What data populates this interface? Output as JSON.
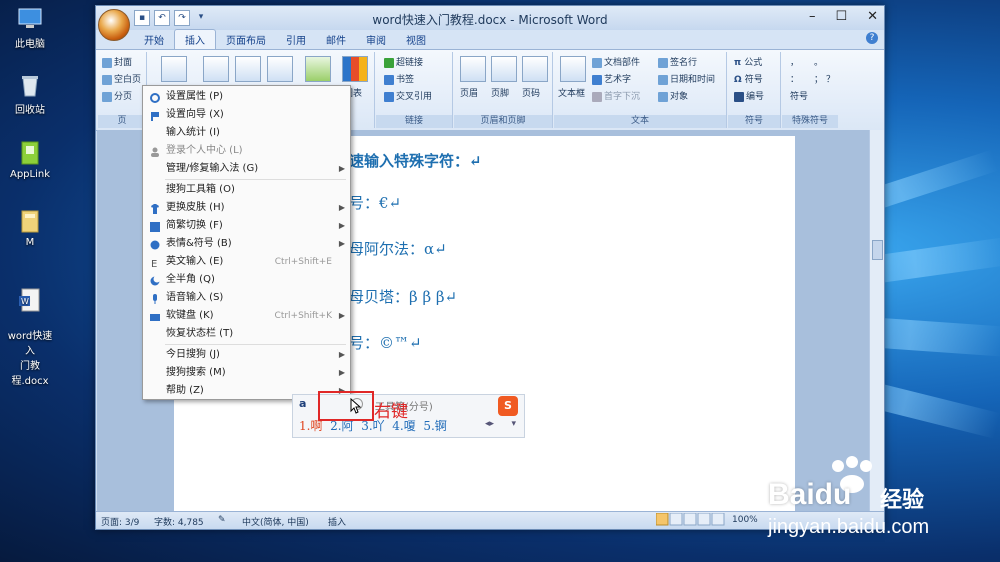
{
  "desktop": {
    "icons": [
      {
        "label": "此电脑"
      },
      {
        "label": "回收站"
      },
      {
        "label": "AppLink"
      },
      {
        "label": "M"
      },
      {
        "label": "word快速入\n门教程.docx"
      }
    ]
  },
  "window": {
    "title": "word快速入门教程.docx - Microsoft Word",
    "controls": {
      "minimize": "–",
      "maximize": "☐",
      "close": "✕"
    }
  },
  "tabs": [
    "开始",
    "插入",
    "页面布局",
    "引用",
    "邮件",
    "审阅",
    "视图"
  ],
  "ribbon": {
    "pages_group": {
      "items": [
        "封面",
        "空白页",
        "分页"
      ],
      "label": "页"
    },
    "illustrations": {
      "chart_label": "图表"
    },
    "links": {
      "items": [
        "超链接",
        "书签",
        "交叉引用"
      ],
      "label": "链接"
    },
    "header_footer": {
      "items": [
        "页眉",
        "页脚",
        "页码"
      ],
      "label": "页眉和页脚"
    },
    "text": {
      "items": [
        "文本框",
        "文档部件",
        "艺术字",
        "首字下沉",
        "签名行",
        "日期和时间",
        "对象"
      ],
      "label": "文本"
    },
    "symbols": {
      "items": [
        "公式",
        "符号",
        "编号"
      ],
      "label": "符号"
    },
    "special_symbols": {
      "items": [
        "，",
        "。",
        "：",
        "；",
        "？",
        "符号"
      ],
      "label": "特殊符号"
    }
  },
  "document": {
    "lines": [
      "速输入特殊字符：↵",
      "号：€↵",
      "母阿尔法：α↵",
      "母贝塔：β  β β↵",
      "号：©™↵"
    ]
  },
  "context_menu": {
    "items": [
      {
        "label": "设置属性",
        "key": "(P)",
        "icon": "gear-icon",
        "submenu": false
      },
      {
        "label": "设置向导",
        "key": "(X)",
        "icon": "flag-icon",
        "submenu": false
      },
      {
        "label": "输入统计",
        "key": "(I)",
        "icon": "",
        "submenu": false
      },
      {
        "label": "登录个人中心",
        "key": "(L)",
        "icon": "user-icon",
        "submenu": false
      },
      {
        "label": "管理/修复输入法",
        "key": "(G)",
        "icon": "",
        "submenu": true
      },
      {
        "label": "搜狗工具箱",
        "key": "(O)",
        "icon": "",
        "submenu": false
      },
      {
        "label": "更换皮肤",
        "key": "(H)",
        "icon": "shirt-icon",
        "submenu": true
      },
      {
        "label": "简繁切换",
        "key": "(F)",
        "icon": "convert-icon",
        "submenu": true
      },
      {
        "label": "表情&符号",
        "key": "(B)",
        "icon": "smiley-icon",
        "submenu": true
      },
      {
        "label": "英文输入",
        "key": "(E)",
        "icon": "letter-e-icon",
        "shortcut": "Ctrl+Shift+E",
        "submenu": false
      },
      {
        "label": "全半角",
        "key": "(Q)",
        "icon": "moon-icon",
        "submenu": false
      },
      {
        "label": "语音输入",
        "key": "(S)",
        "icon": "mic-icon",
        "submenu": false
      },
      {
        "label": "软键盘",
        "key": "(K)",
        "icon": "keyboard-icon",
        "shortcut": "Ctrl+Shift+K",
        "submenu": true
      },
      {
        "label": "恢复状态栏",
        "key": "(T)",
        "icon": "",
        "submenu": false
      },
      {
        "label": "今日搜狗",
        "key": "(J)",
        "icon": "",
        "submenu": true
      },
      {
        "label": "搜狗搜索",
        "key": "(M)",
        "icon": "",
        "submenu": true
      },
      {
        "label": "帮助",
        "key": "(Z)",
        "icon": "",
        "submenu": true
      }
    ]
  },
  "ime_bar": {
    "input_char": "a",
    "tooltip": "工具箱(分号)",
    "candidates": [
      "1.啊",
      "2.阿",
      "3.吖",
      "4.嗄",
      "5.锕"
    ]
  },
  "annotation": {
    "right_click": "右键"
  },
  "statusbar": {
    "page": "页面: 3/9",
    "words": "字数: 4,785",
    "language": "中文(简体, 中国)",
    "mode": "插入",
    "zoom": "100%"
  },
  "watermark": {
    "brand": "Baidu",
    "brand_cn": "经验",
    "url": "jingyan.baidu.com"
  },
  "colors": {
    "accent": "#15428b",
    "annotation_red": "#e02727",
    "doc_text": "#1e6fb0"
  }
}
